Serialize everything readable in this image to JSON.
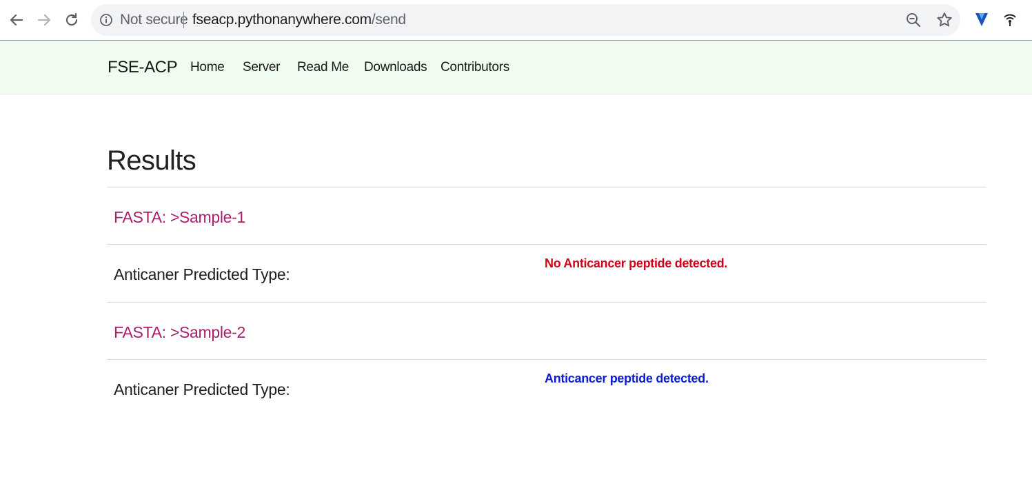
{
  "browser": {
    "security_label": "Not secure",
    "url_host": "fseacp.pythonanywhere.com",
    "url_path": "/send",
    "icons": [
      "back-arrow-icon",
      "forward-arrow-icon",
      "reload-icon",
      "info-icon",
      "zoom-out-icon",
      "star-icon",
      "extension-v-icon",
      "extension-wifi-icon"
    ]
  },
  "navbar": {
    "brand": "FSE-ACP",
    "links": [
      "Home",
      "Server",
      "Read Me",
      "Downloads",
      "Contributors"
    ]
  },
  "main": {
    "title": "Results",
    "results": [
      {
        "fasta_label": "FASTA: >Sample-1",
        "prediction_label": "Anticaner Predicted Type:",
        "prediction_value": "No Anticancer peptide detected.",
        "prediction_color": "#d0021b"
      },
      {
        "fasta_label": "FASTA: >Sample-2",
        "prediction_label": "Anticaner Predicted Type:",
        "prediction_value": "Anticancer peptide detected.",
        "prediction_color": "#0a1cd6"
      }
    ]
  },
  "colors": {
    "navbar_bg": "#f0fcf0",
    "fasta_label": "#a81f6b"
  }
}
